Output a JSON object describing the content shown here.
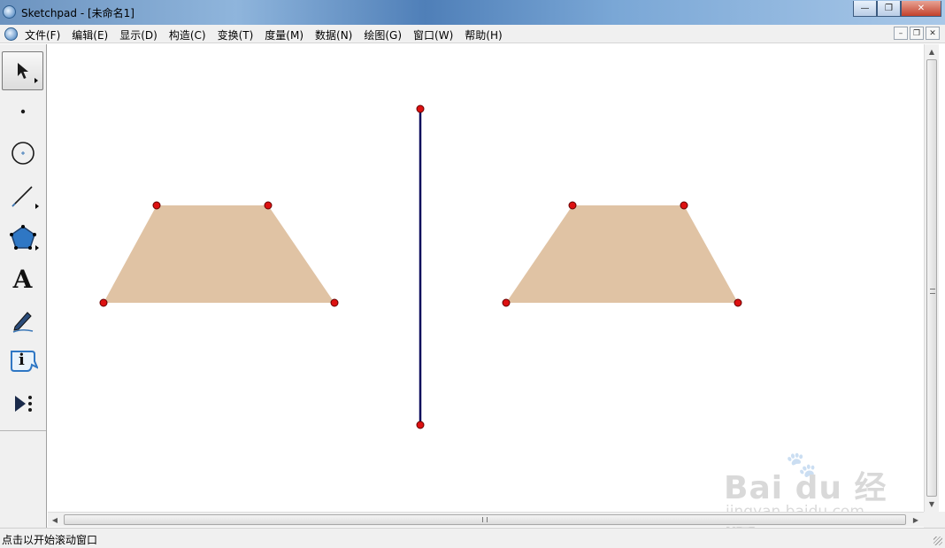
{
  "window": {
    "title": "Sketchpad  - [未命名1]"
  },
  "menubar": {
    "items": [
      "文件(F)",
      "编辑(E)",
      "显示(D)",
      "构造(C)",
      "变换(T)",
      "度量(M)",
      "数据(N)",
      "绘图(G)",
      "窗口(W)",
      "帮助(H)"
    ]
  },
  "toolbox": {
    "tools": [
      {
        "name": "arrow-selection-tool",
        "icon": "arrow-cursor-icon",
        "selected": true
      },
      {
        "name": "point-tool",
        "icon": "point-icon"
      },
      {
        "name": "compass-tool",
        "icon": "circle-icon"
      },
      {
        "name": "straightedge-tool",
        "icon": "segment-icon"
      },
      {
        "name": "polygon-tool",
        "icon": "pentagon-icon"
      },
      {
        "name": "text-tool",
        "icon": "text-a-icon"
      },
      {
        "name": "marker-tool",
        "icon": "pen-icon"
      },
      {
        "name": "information-tool",
        "icon": "info-icon"
      },
      {
        "name": "custom-tool",
        "icon": "custom-tools-icon"
      }
    ],
    "text_tool_glyph": "A",
    "info_tool_glyph": "i"
  },
  "colors": {
    "polygon_fill": "#e0c3a4",
    "point_fill": "#dd1111",
    "point_stroke": "#660000",
    "mirror_line": "#0a0a5c",
    "accent": "#3b78b8"
  },
  "statusbar": {
    "message": "点击以开始滚动窗口"
  },
  "watermark": {
    "brand": "Bai du 经验",
    "url": "jingyan.baidu.com"
  }
}
